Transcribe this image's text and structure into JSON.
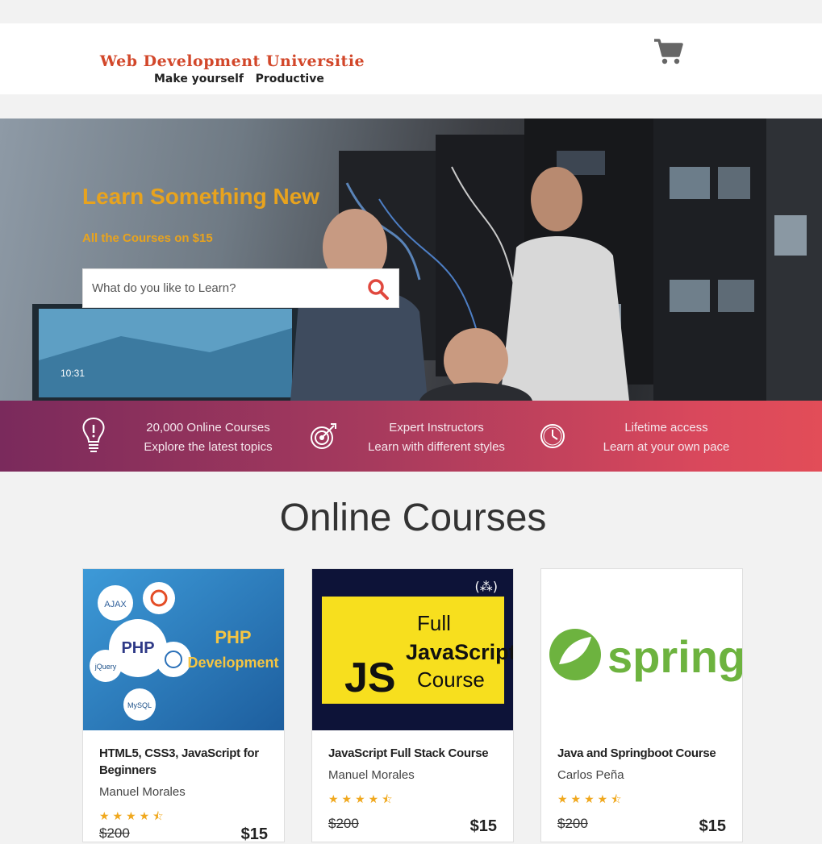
{
  "header": {
    "logo_title": "Web Development Universitie",
    "logo_tagline": "Make yourself   Productive"
  },
  "hero": {
    "title": "Learn Something New",
    "subtitle": "All the Courses on $15",
    "search": {
      "placeholder": "What do you like to Learn?",
      "value": ""
    }
  },
  "features": [
    {
      "icon": "lightbulb-icon",
      "line1": "20,000 Online Courses",
      "line2": "Explore the latest topics"
    },
    {
      "icon": "target-icon",
      "line1": "Expert Instructors",
      "line2": "Learn with different styles"
    },
    {
      "icon": "clock-icon",
      "line1": "Lifetime access",
      "line2": "Learn at your own pace"
    }
  ],
  "section_title": "Online Courses",
  "courses": [
    {
      "title": "HTML5, CSS3, JavaScript for Beginners",
      "author": "Manuel Morales",
      "rating_stars": "★★★★⯪",
      "old_price": "$200",
      "price": "$15",
      "thumb_labels": [
        "PHP",
        "PHP",
        "Development",
        "AJAX",
        "jQuery",
        "MySQL"
      ]
    },
    {
      "title": "JavaScript Full Stack Course",
      "author": "Manuel Morales",
      "rating_stars": "★★★★⯪",
      "old_price": "$200",
      "price": "$15",
      "thumb_labels": [
        "JS",
        "Full",
        "JavaScript",
        "Course",
        "(⁂)"
      ]
    },
    {
      "title": "Java and Springboot Course",
      "author": "Carlos Peña",
      "rating_stars": "★★★★⯪",
      "old_price": "$200",
      "price": "$15",
      "thumb_labels": [
        "spring"
      ]
    }
  ],
  "colors": {
    "accent": "#e8a31e",
    "danger": "#e0483e",
    "feature_gradient_start": "#7a2a5c",
    "feature_gradient_end": "#e24d58",
    "js_yellow": "#f7df1e",
    "spring_green": "#6db33f",
    "navy": "#0d1338"
  }
}
